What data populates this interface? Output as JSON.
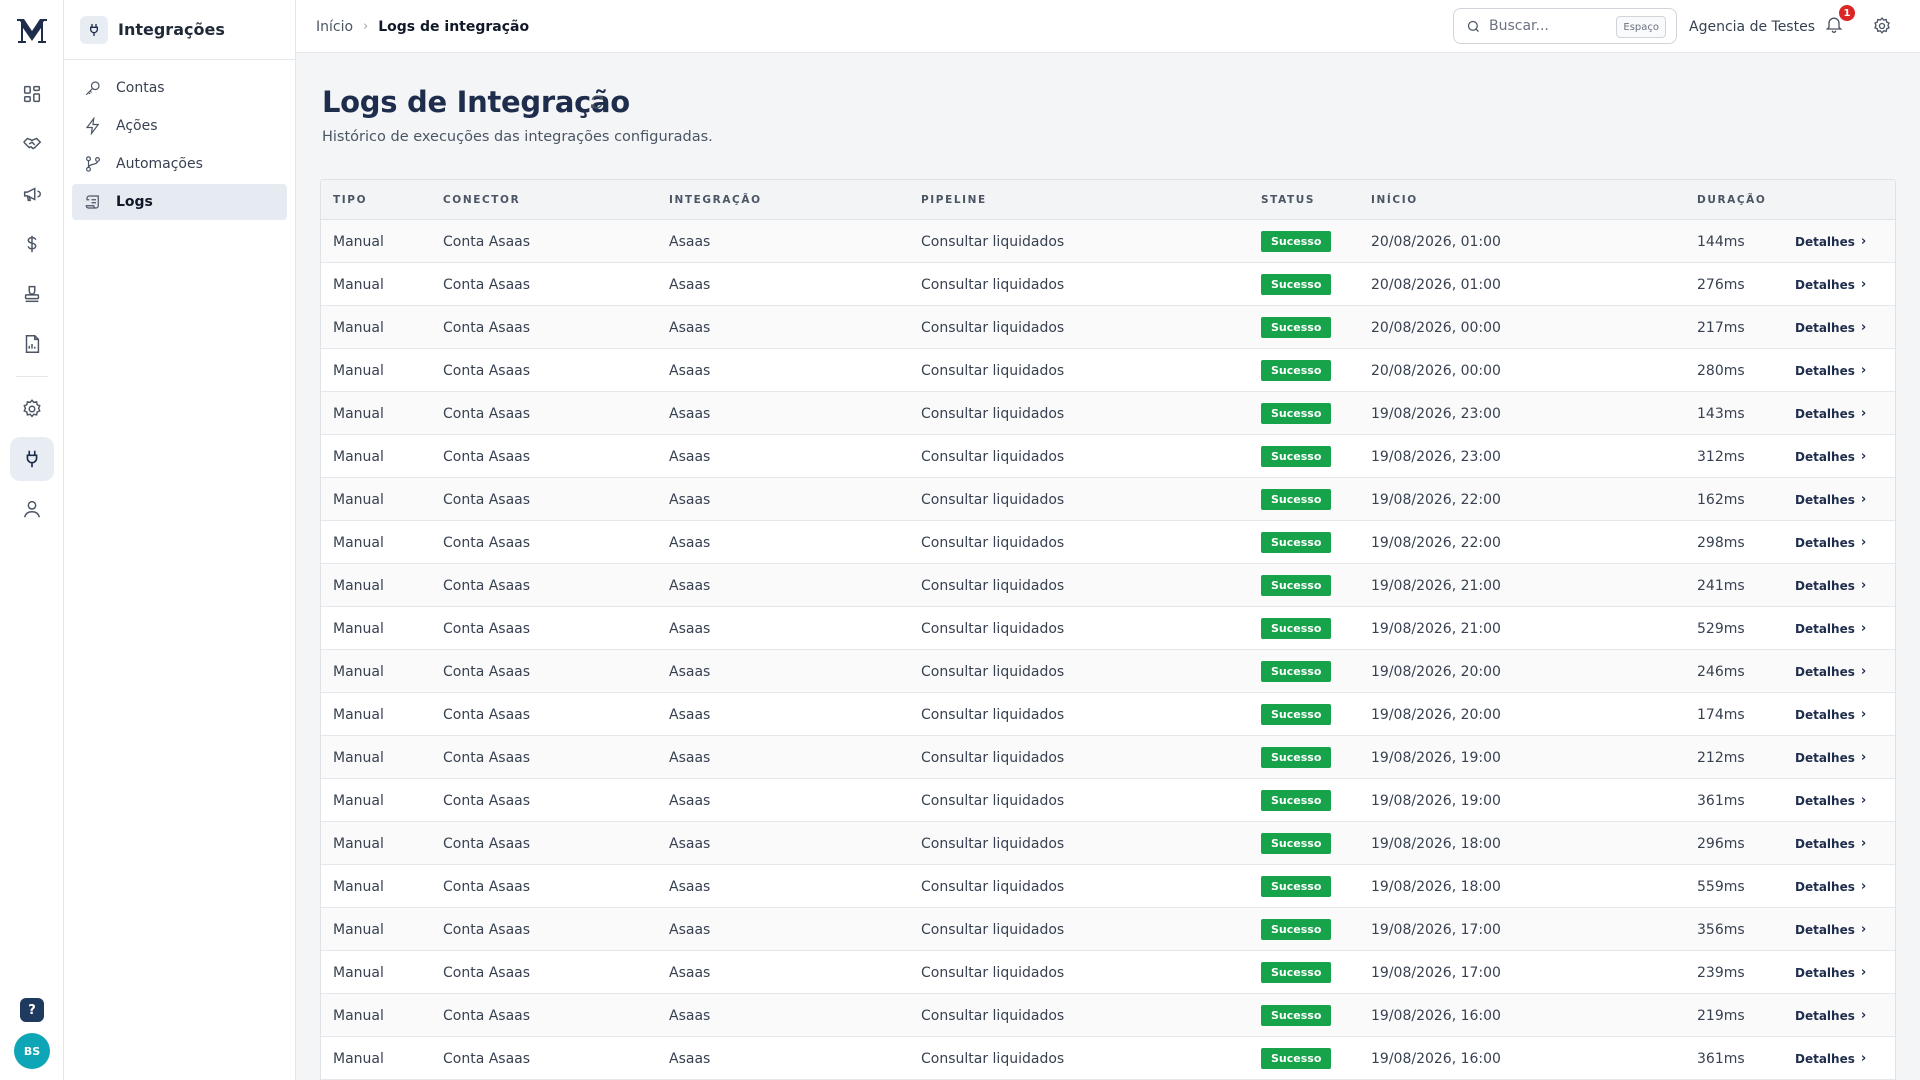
{
  "app": {
    "logo_letter": "M"
  },
  "rail": {
    "items": [
      {
        "icon": "dashboard-icon"
      },
      {
        "icon": "handshake-icon"
      },
      {
        "icon": "megaphone-icon"
      },
      {
        "icon": "dollar-icon"
      },
      {
        "icon": "stamp-icon"
      },
      {
        "icon": "report-icon"
      },
      {
        "icon": "gear-icon"
      },
      {
        "icon": "plug-icon",
        "active": true
      },
      {
        "icon": "user-icon"
      }
    ],
    "help_label": "?",
    "avatar_initials": "BS"
  },
  "subnav": {
    "title": "Integrações",
    "items": [
      {
        "label": "Contas",
        "icon": "key-icon"
      },
      {
        "label": "Ações",
        "icon": "lightning-icon"
      },
      {
        "label": "Automações",
        "icon": "branch-icon"
      },
      {
        "label": "Logs",
        "icon": "scroll-icon",
        "active": true
      }
    ]
  },
  "topbar": {
    "breadcrumb": [
      "Início",
      "Logs de integração"
    ],
    "search_placeholder": "Buscar...",
    "search_shortcut": "Espaço",
    "organization": "Agencia de Testes",
    "notification_count": "1"
  },
  "page": {
    "title": "Logs de Integração",
    "subtitle": "Histórico de execuções das integrações configuradas."
  },
  "table": {
    "columns": [
      "Tipo",
      "Conector",
      "Integração",
      "Pipeline",
      "Status",
      "Início",
      "Duração"
    ],
    "details_label": "Detalhes",
    "rows": [
      {
        "tipo": "Manual",
        "conector": "Conta Asaas",
        "integracao": "Asaas",
        "pipeline": "Consultar liquidados",
        "status": "Sucesso",
        "inicio": "20/08/2026, 01:00",
        "duracao": "144ms"
      },
      {
        "tipo": "Manual",
        "conector": "Conta Asaas",
        "integracao": "Asaas",
        "pipeline": "Consultar liquidados",
        "status": "Sucesso",
        "inicio": "20/08/2026, 01:00",
        "duracao": "276ms"
      },
      {
        "tipo": "Manual",
        "conector": "Conta Asaas",
        "integracao": "Asaas",
        "pipeline": "Consultar liquidados",
        "status": "Sucesso",
        "inicio": "20/08/2026, 00:00",
        "duracao": "217ms"
      },
      {
        "tipo": "Manual",
        "conector": "Conta Asaas",
        "integracao": "Asaas",
        "pipeline": "Consultar liquidados",
        "status": "Sucesso",
        "inicio": "20/08/2026, 00:00",
        "duracao": "280ms"
      },
      {
        "tipo": "Manual",
        "conector": "Conta Asaas",
        "integracao": "Asaas",
        "pipeline": "Consultar liquidados",
        "status": "Sucesso",
        "inicio": "19/08/2026, 23:00",
        "duracao": "143ms"
      },
      {
        "tipo": "Manual",
        "conector": "Conta Asaas",
        "integracao": "Asaas",
        "pipeline": "Consultar liquidados",
        "status": "Sucesso",
        "inicio": "19/08/2026, 23:00",
        "duracao": "312ms"
      },
      {
        "tipo": "Manual",
        "conector": "Conta Asaas",
        "integracao": "Asaas",
        "pipeline": "Consultar liquidados",
        "status": "Sucesso",
        "inicio": "19/08/2026, 22:00",
        "duracao": "162ms"
      },
      {
        "tipo": "Manual",
        "conector": "Conta Asaas",
        "integracao": "Asaas",
        "pipeline": "Consultar liquidados",
        "status": "Sucesso",
        "inicio": "19/08/2026, 22:00",
        "duracao": "298ms"
      },
      {
        "tipo": "Manual",
        "conector": "Conta Asaas",
        "integracao": "Asaas",
        "pipeline": "Consultar liquidados",
        "status": "Sucesso",
        "inicio": "19/08/2026, 21:00",
        "duracao": "241ms"
      },
      {
        "tipo": "Manual",
        "conector": "Conta Asaas",
        "integracao": "Asaas",
        "pipeline": "Consultar liquidados",
        "status": "Sucesso",
        "inicio": "19/08/2026, 21:00",
        "duracao": "529ms"
      },
      {
        "tipo": "Manual",
        "conector": "Conta Asaas",
        "integracao": "Asaas",
        "pipeline": "Consultar liquidados",
        "status": "Sucesso",
        "inicio": "19/08/2026, 20:00",
        "duracao": "246ms"
      },
      {
        "tipo": "Manual",
        "conector": "Conta Asaas",
        "integracao": "Asaas",
        "pipeline": "Consultar liquidados",
        "status": "Sucesso",
        "inicio": "19/08/2026, 20:00",
        "duracao": "174ms"
      },
      {
        "tipo": "Manual",
        "conector": "Conta Asaas",
        "integracao": "Asaas",
        "pipeline": "Consultar liquidados",
        "status": "Sucesso",
        "inicio": "19/08/2026, 19:00",
        "duracao": "212ms"
      },
      {
        "tipo": "Manual",
        "conector": "Conta Asaas",
        "integracao": "Asaas",
        "pipeline": "Consultar liquidados",
        "status": "Sucesso",
        "inicio": "19/08/2026, 19:00",
        "duracao": "361ms"
      },
      {
        "tipo": "Manual",
        "conector": "Conta Asaas",
        "integracao": "Asaas",
        "pipeline": "Consultar liquidados",
        "status": "Sucesso",
        "inicio": "19/08/2026, 18:00",
        "duracao": "296ms"
      },
      {
        "tipo": "Manual",
        "conector": "Conta Asaas",
        "integracao": "Asaas",
        "pipeline": "Consultar liquidados",
        "status": "Sucesso",
        "inicio": "19/08/2026, 18:00",
        "duracao": "559ms"
      },
      {
        "tipo": "Manual",
        "conector": "Conta Asaas",
        "integracao": "Asaas",
        "pipeline": "Consultar liquidados",
        "status": "Sucesso",
        "inicio": "19/08/2026, 17:00",
        "duracao": "356ms"
      },
      {
        "tipo": "Manual",
        "conector": "Conta Asaas",
        "integracao": "Asaas",
        "pipeline": "Consultar liquidados",
        "status": "Sucesso",
        "inicio": "19/08/2026, 17:00",
        "duracao": "239ms"
      },
      {
        "tipo": "Manual",
        "conector": "Conta Asaas",
        "integracao": "Asaas",
        "pipeline": "Consultar liquidados",
        "status": "Sucesso",
        "inicio": "19/08/2026, 16:00",
        "duracao": "219ms"
      },
      {
        "tipo": "Manual",
        "conector": "Conta Asaas",
        "integracao": "Asaas",
        "pipeline": "Consultar liquidados",
        "status": "Sucesso",
        "inicio": "19/08/2026, 16:00",
        "duracao": "361ms"
      }
    ]
  },
  "colors": {
    "brand": "#1f2d4d",
    "success": "#16a34a",
    "notification": "#dc2626",
    "avatar": "#0ea5b7"
  }
}
